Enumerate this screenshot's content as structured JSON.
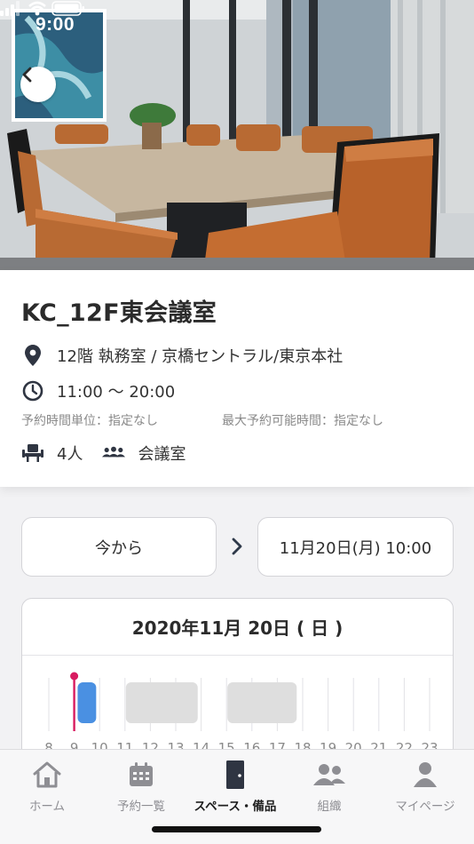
{
  "status_bar": {
    "time": "9:00"
  },
  "room": {
    "title": "KC_12F東会議室",
    "location": "12階 執務室 / 京橋セントラル/東京本社",
    "hours": "11:00 〜 20:00",
    "unit_label": "予約時間単位：指定なし",
    "max_label": "最大予約可能時間：指定なし",
    "capacity": "4人",
    "type": "会議室"
  },
  "booking": {
    "from_label": "今から",
    "to_label": "11月20日(月) 10:00"
  },
  "schedule": {
    "date": "2020年11月 20日 ( 日 )",
    "hours": [
      "8",
      "9",
      "10",
      "11",
      "12",
      "13",
      "14",
      "15",
      "16",
      "17",
      "18",
      "19",
      "20",
      "21",
      "22",
      "23"
    ],
    "current_time_hour": 9.0,
    "selected_block": {
      "start": 9.1,
      "end": 9.9
    },
    "booked_blocks": [
      {
        "start": 11.0,
        "end": 13.9
      },
      {
        "start": 15.0,
        "end": 17.8
      }
    ],
    "colors": {
      "selected": "#4a90e2",
      "booked": "#dedede",
      "now_marker": "#d81b60"
    }
  },
  "tabs": [
    {
      "key": "home",
      "label": "ホーム",
      "icon": "home-icon"
    },
    {
      "key": "bookings",
      "label": "予約一覧",
      "icon": "calendar-icon"
    },
    {
      "key": "spaces",
      "label": "スペース・備品",
      "icon": "door-icon",
      "active": true
    },
    {
      "key": "org",
      "label": "組織",
      "icon": "people-icon"
    },
    {
      "key": "mypage",
      "label": "マイページ",
      "icon": "person-icon"
    }
  ]
}
